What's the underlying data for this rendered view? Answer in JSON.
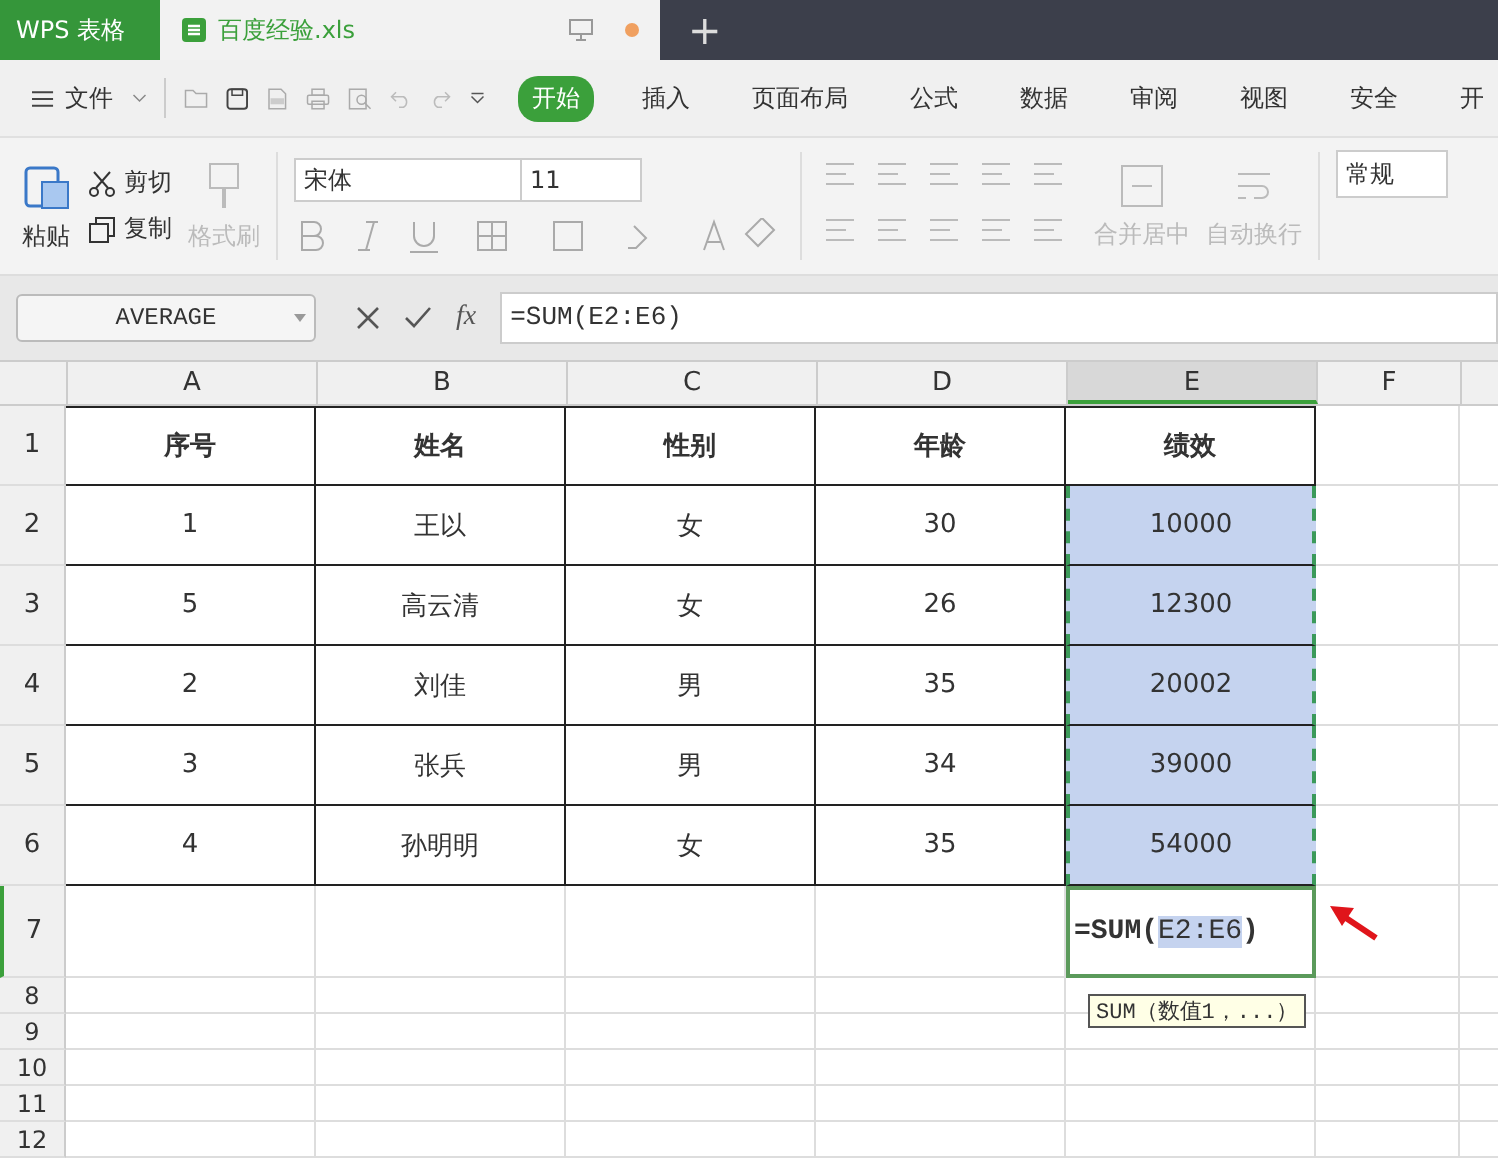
{
  "title_bar": {
    "app_tab": "WPS 表格",
    "file_tab": "百度经验.xls",
    "new_tab": "+"
  },
  "menu": {
    "file": "文件",
    "tabs": [
      {
        "label": "开始",
        "selected": true
      },
      {
        "label": "插入",
        "selected": false
      },
      {
        "label": "页面布局",
        "selected": false
      },
      {
        "label": "公式",
        "selected": false
      },
      {
        "label": "数据",
        "selected": false
      },
      {
        "label": "审阅",
        "selected": false
      },
      {
        "label": "视图",
        "selected": false
      },
      {
        "label": "安全",
        "selected": false
      },
      {
        "label": "开",
        "selected": false
      }
    ]
  },
  "ribbon": {
    "paste": "粘贴",
    "cut": "剪切",
    "copy": "复制",
    "format_painter": {
      "label": "格式刷",
      "disabled": true
    },
    "font": "宋体",
    "size": "11",
    "merge": {
      "label": "合并居中",
      "disabled": true
    },
    "wrap": {
      "label": "自动换行",
      "disabled": true
    },
    "number_format": "常规"
  },
  "formula_bar": {
    "name_box": "AVERAGE",
    "fx": "fx",
    "formula": "=SUM(E2:E6)"
  },
  "columns": [
    {
      "label": "A",
      "selected": false
    },
    {
      "label": "B",
      "selected": false
    },
    {
      "label": "C",
      "selected": false
    },
    {
      "label": "D",
      "selected": false
    },
    {
      "label": "E",
      "selected": true
    },
    {
      "label": "F",
      "selected": false
    }
  ],
  "rows": [
    {
      "header": "1",
      "bold": true,
      "cells": [
        {
          "text": "序号",
          "selected": false
        },
        {
          "text": "姓名",
          "selected": false
        },
        {
          "text": "性别",
          "selected": false
        },
        {
          "text": "年龄",
          "selected": false
        },
        {
          "text": "绩效",
          "selected": false
        }
      ]
    },
    {
      "header": "2",
      "bold": false,
      "cells": [
        {
          "text": "1",
          "selected": false
        },
        {
          "text": "王以",
          "selected": false
        },
        {
          "text": "女",
          "selected": false
        },
        {
          "text": "30",
          "selected": false
        },
        {
          "text": "10000",
          "selected": true
        }
      ]
    },
    {
      "header": "3",
      "bold": false,
      "cells": [
        {
          "text": "5",
          "selected": false
        },
        {
          "text": "高云清",
          "selected": false
        },
        {
          "text": "女",
          "selected": false
        },
        {
          "text": "26",
          "selected": false
        },
        {
          "text": "12300",
          "selected": true
        }
      ]
    },
    {
      "header": "4",
      "bold": false,
      "cells": [
        {
          "text": "2",
          "selected": false
        },
        {
          "text": "刘佳",
          "selected": false
        },
        {
          "text": "男",
          "selected": false
        },
        {
          "text": "35",
          "selected": false
        },
        {
          "text": "20002",
          "selected": true
        }
      ]
    },
    {
      "header": "5",
      "bold": false,
      "cells": [
        {
          "text": "3",
          "selected": false
        },
        {
          "text": "张兵",
          "selected": false
        },
        {
          "text": "男",
          "selected": false
        },
        {
          "text": "34",
          "selected": false
        },
        {
          "text": "39000",
          "selected": true
        }
      ]
    },
    {
      "header": "6",
      "bold": false,
      "cells": [
        {
          "text": "4",
          "selected": false
        },
        {
          "text": "孙明明",
          "selected": false
        },
        {
          "text": "女",
          "selected": false
        },
        {
          "text": "35",
          "selected": false
        },
        {
          "text": "54000",
          "selected": true
        }
      ]
    }
  ],
  "editing_row": {
    "header": "7",
    "formula_start": "=SUM(",
    "formula_ref": "E2:E6",
    "formula_end": ")",
    "tooltip": "SUM（数值1，...）"
  },
  "empty_rows": [
    "8",
    "9",
    "10",
    "11",
    "12"
  ]
}
